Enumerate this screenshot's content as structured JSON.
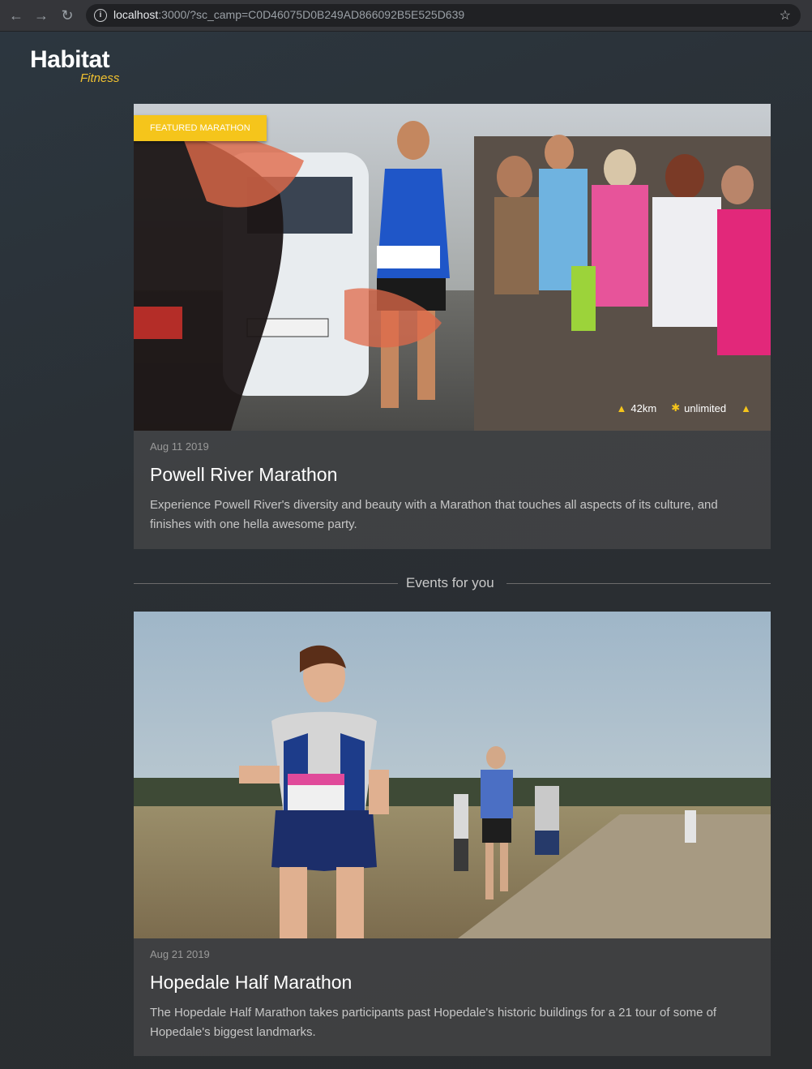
{
  "browser": {
    "url_host": "localhost",
    "url_rest": ":3000/?sc_camp=C0D46075D0B249AD866092B5E525D639"
  },
  "logo": {
    "brand": "Habitat",
    "sub": "Fitness"
  },
  "featured": {
    "badge": "FEATURED MARATHON",
    "date": "Aug 11 2019",
    "title": "Powell River Marathon",
    "description": "Experience Powell River's diversity and beauty with a Marathon that touches all aspects of its culture, and finishes with one hella awesome party.",
    "distance": "42km",
    "participants": "unlimited"
  },
  "divider": {
    "label": "Events for you"
  },
  "events": [
    {
      "date": "Aug 21 2019",
      "title": "Hopedale Half Marathon",
      "description": "The Hopedale Half Marathon takes participants past Hopedale's historic buildings for a 21 tour of some of Hopedale's biggest landmarks."
    }
  ],
  "colors": {
    "accent": "#f5c51b",
    "background": "#2b3036"
  },
  "icons": [
    "back-arrow-icon",
    "forward-arrow-icon",
    "reload-icon",
    "info-icon",
    "star-icon",
    "map-icon",
    "runner-icon",
    "road-icon"
  ]
}
